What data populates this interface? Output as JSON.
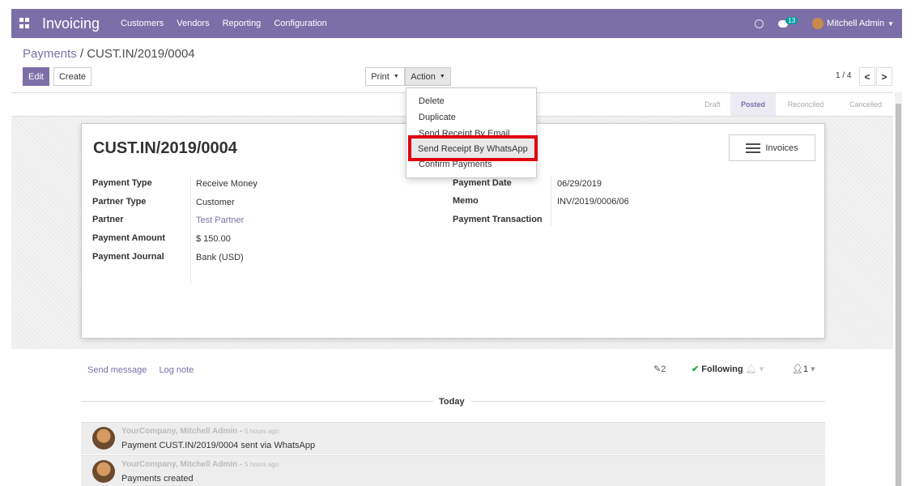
{
  "navbar": {
    "app_name": "Invoicing",
    "menus": [
      "Customers",
      "Vendors",
      "Reporting",
      "Configuration"
    ],
    "chat_count": "13",
    "user_name": "Mitchell Admin"
  },
  "breadcrumb": {
    "parent": "Payments",
    "separator": " / ",
    "current": "CUST.IN/2019/0004"
  },
  "toolbar": {
    "edit_label": "Edit",
    "create_label": "Create",
    "print_label": "Print",
    "action_label": "Action"
  },
  "pager": {
    "value": "1 / 4",
    "prev": "<",
    "next": ">"
  },
  "status_stages": [
    "Draft",
    "Posted",
    "Reconciled",
    "Cancelled"
  ],
  "status_active": "Posted",
  "record": {
    "title": "CUST.IN/2019/0004",
    "invoices_button": "Invoices",
    "left_fields": [
      {
        "label": "Payment Type",
        "value": "Receive Money"
      },
      {
        "label": "Partner Type",
        "value": "Customer"
      },
      {
        "label": "Partner",
        "value": "Test Partner"
      },
      {
        "label": "Payment Amount",
        "value": "$ 150.00"
      },
      {
        "label": "Payment Journal",
        "value": "Bank (USD)"
      }
    ],
    "right_fields": [
      {
        "label": "Payment Date",
        "value": "06/29/2019"
      },
      {
        "label": "Memo",
        "value": "INV/2019/0006/06"
      },
      {
        "label": "Payment Transaction",
        "value": ""
      }
    ]
  },
  "action_menu": {
    "items": [
      "Delete",
      "Duplicate",
      "Send Receipt By Email",
      "Send Receipt By WhatsApp",
      "Confirm Payments"
    ],
    "highlighted": "Send Receipt By WhatsApp"
  },
  "chatter": {
    "send_message": "Send message",
    "log_note": "Log note",
    "attachments": "2",
    "following": "Following",
    "followers": "1",
    "date_separator": "Today",
    "messages": [
      {
        "author": "YourCompany, Mitchell Admin",
        "time": "5 hours ago",
        "body": "Payment CUST.IN/2019/0004 sent via WhatsApp"
      },
      {
        "author": "YourCompany, Mitchell Admin",
        "time": "5 hours ago",
        "body": "Payments created"
      }
    ]
  },
  "colors": {
    "brand": "#7c6fa8",
    "highlight_border": "#e0000f",
    "following": "#28a745"
  }
}
